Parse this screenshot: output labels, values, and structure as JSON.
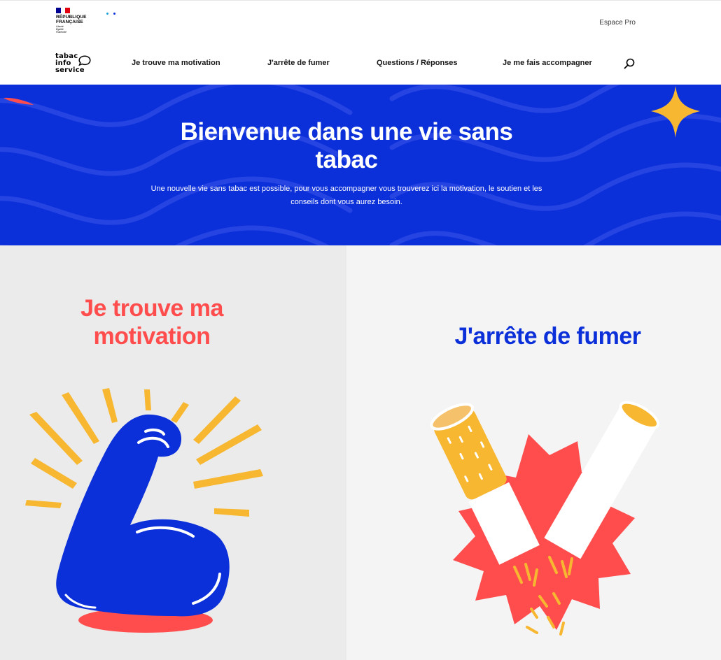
{
  "header": {
    "republique_name": "RÉPUBLIQUE\nFRANÇAISE",
    "republique_motto": "Liberté\nÉgalité\nFraternité",
    "espace_pro": "Espace Pro",
    "logo_lines": [
      "tabac",
      "info",
      "service"
    ],
    "nav": [
      {
        "label": "Je trouve ma motivation"
      },
      {
        "label": "J'arrête de fumer"
      },
      {
        "label": "Questions / Réponses"
      },
      {
        "label": "Je me fais accompagner"
      }
    ],
    "search_icon": "search-icon"
  },
  "hero": {
    "title": "Bienvenue dans une vie sans tabac",
    "subtitle": "Une nouvelle vie sans tabac est possible, pour vous accompagner vous trouverez ici la motivation, le soutien et les conseils dont vous aurez besoin."
  },
  "cards": [
    {
      "title": "Je trouve ma motivation",
      "icon": "flexed-arm-icon"
    },
    {
      "title": "J'arrête de fumer",
      "icon": "broken-cigarette-icon"
    }
  ],
  "colors": {
    "brand_blue": "#0b2fd9",
    "accent_red": "#ff4d4d",
    "accent_yellow": "#f7b731",
    "flag_blue": "#000091",
    "flag_red": "#e1000f"
  }
}
